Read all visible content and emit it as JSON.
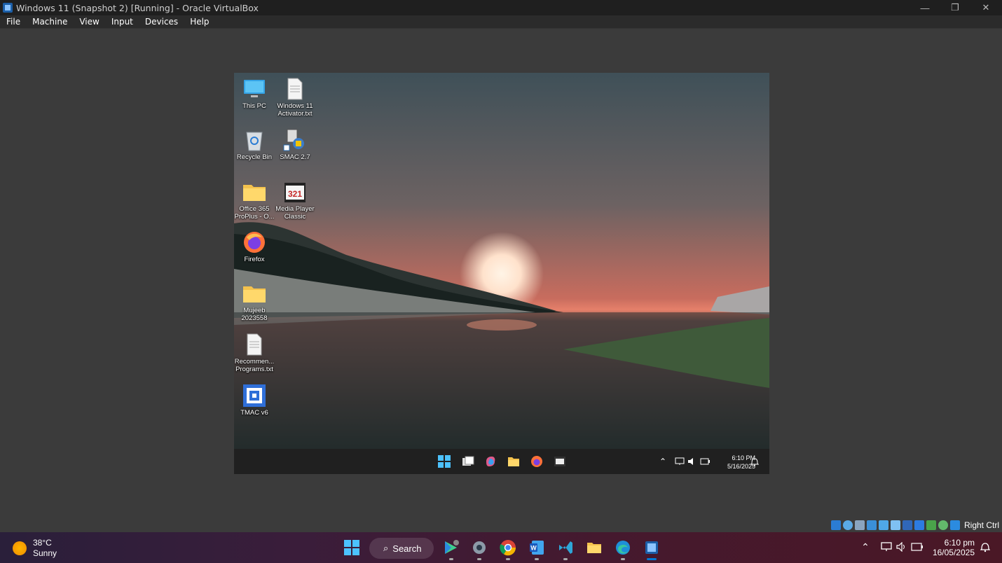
{
  "window": {
    "title": "Windows 11 (Snapshot 2) [Running] - Oracle VirtualBox",
    "icons": [
      "virtualbox-icon",
      "minimize-icon",
      "restore-icon",
      "close-icon"
    ]
  },
  "menubar": {
    "items": [
      {
        "label": "File"
      },
      {
        "label": "Machine"
      },
      {
        "label": "View"
      },
      {
        "label": "Input"
      },
      {
        "label": "Devices"
      },
      {
        "label": "Help"
      }
    ]
  },
  "guest": {
    "desktop_icons": [
      {
        "label": "This PC",
        "icon": "computer-icon"
      },
      {
        "label": "Windows 11 Activator.txt",
        "icon": "text-file-icon"
      },
      {
        "label": "Recycle Bin",
        "icon": "recycle-bin-icon"
      },
      {
        "label": "SMAC 2.7",
        "icon": "smac-icon"
      },
      {
        "label": "Office 365 ProPlus - O...",
        "icon": "folder-icon"
      },
      {
        "label": "Media Player Classic",
        "icon": "mpc-icon"
      },
      {
        "label": "Firefox",
        "icon": "firefox-icon"
      },
      {
        "label": "Mujeeb 2023558",
        "icon": "folder-icon"
      },
      {
        "label": "Recommen... Programs.txt",
        "icon": "text-file-icon"
      },
      {
        "label": "TMAC v6",
        "icon": "tmac-icon"
      }
    ],
    "taskbar": {
      "apps": [
        "start-icon",
        "task-view-icon",
        "copilot-icon",
        "file-explorer-icon",
        "firefox-icon",
        "media-player-classic-icon"
      ],
      "tray": [
        "chevron-up-icon",
        "network-icon",
        "volume-icon",
        "battery-icon",
        "bell-icon"
      ],
      "time": "6:10 PM",
      "date": "5/16/2025"
    }
  },
  "statusbar": {
    "icons": [
      "hard-disk-icon",
      "optical-drive-icon",
      "audio-icon",
      "network-icon",
      "usb-icon",
      "shared-folders-icon",
      "display-icon",
      "recording-icon",
      "cpu-icon",
      "mouse-integration-icon",
      "download-icon"
    ],
    "host_key": "Right Ctrl"
  },
  "host_taskbar": {
    "weather": {
      "temp": "38°C",
      "condition": "Sunny"
    },
    "search_label": "Search",
    "apps": [
      "start-icon",
      "search-icon",
      "bluestacks-icon",
      "settings-icon",
      "chrome-icon",
      "word-icon",
      "visual-studio-icon",
      "file-explorer-icon",
      "edge-icon",
      "virtualbox-icon"
    ],
    "tray": [
      "chevron-up-icon",
      "network-icon",
      "volume-icon",
      "battery-icon",
      "notification-icon"
    ],
    "time": "6:10 pm",
    "date": "16/05/2025",
    "colors": {
      "accent": "#0078d4"
    }
  }
}
